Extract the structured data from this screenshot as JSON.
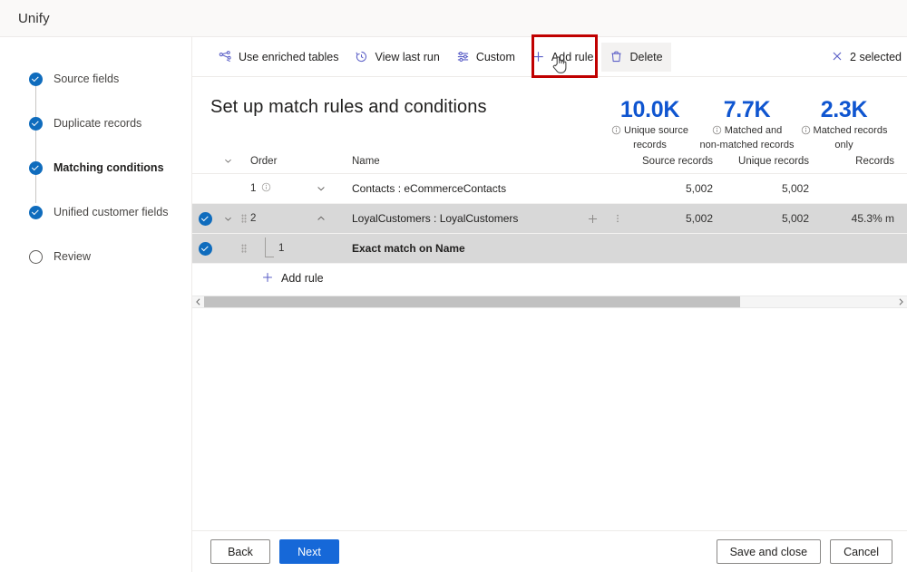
{
  "app": {
    "title": "Unify"
  },
  "wizard": {
    "steps": [
      {
        "label": "Source fields",
        "state": "done"
      },
      {
        "label": "Duplicate records",
        "state": "done"
      },
      {
        "label": "Matching conditions",
        "state": "current"
      },
      {
        "label": "Unified customer fields",
        "state": "done"
      },
      {
        "label": "Review",
        "state": "todo"
      }
    ]
  },
  "toolbar": {
    "items": [
      {
        "label": "Use enriched tables",
        "icon": "enriched-tables-icon"
      },
      {
        "label": "View last run",
        "icon": "history-clock-icon"
      },
      {
        "label": "Custom",
        "icon": "sliders-icon"
      },
      {
        "label": "Add rule",
        "icon": "plus-icon"
      },
      {
        "label": "Delete",
        "icon": "trash-icon"
      }
    ],
    "highlighted_item": "Delete",
    "selection": {
      "label": "2 selected",
      "icon": "close-icon"
    },
    "highlight_color": "#c00000"
  },
  "main": {
    "page_title": "Set up match rules and conditions",
    "kpis": [
      {
        "value": "10.0K",
        "label_line1": "Unique source",
        "label_line2": "records"
      },
      {
        "value": "7.7K",
        "label_line1": "Matched and",
        "label_line2": "non-matched records"
      },
      {
        "value": "2.3K",
        "label_line1": "Matched records",
        "label_line2": "only"
      }
    ],
    "kpi_color": "#0f55d0",
    "table": {
      "headers": {
        "order": "Order",
        "name": "Name",
        "source_records": "Source records",
        "unique_records": "Unique records",
        "records": "Records"
      },
      "rows": [
        {
          "order": "1",
          "name": "Contacts : eCommerceContacts",
          "source_records": "5,002",
          "unique_records": "5,002",
          "records": "",
          "selected": false,
          "expanded": false
        },
        {
          "order": "2",
          "name": "LoyalCustomers : LoyalCustomers",
          "source_records": "5,002",
          "unique_records": "5,002",
          "records": "45.3% m",
          "selected": true,
          "expanded": true
        }
      ],
      "subrow": {
        "order": "1",
        "name": "Exact match on Name",
        "selected": true
      },
      "add_rule_label": "Add rule"
    }
  },
  "footer": {
    "back": "Back",
    "next": "Next",
    "save_and_close": "Save and close",
    "cancel": "Cancel",
    "primary_color": "#1668d8"
  }
}
